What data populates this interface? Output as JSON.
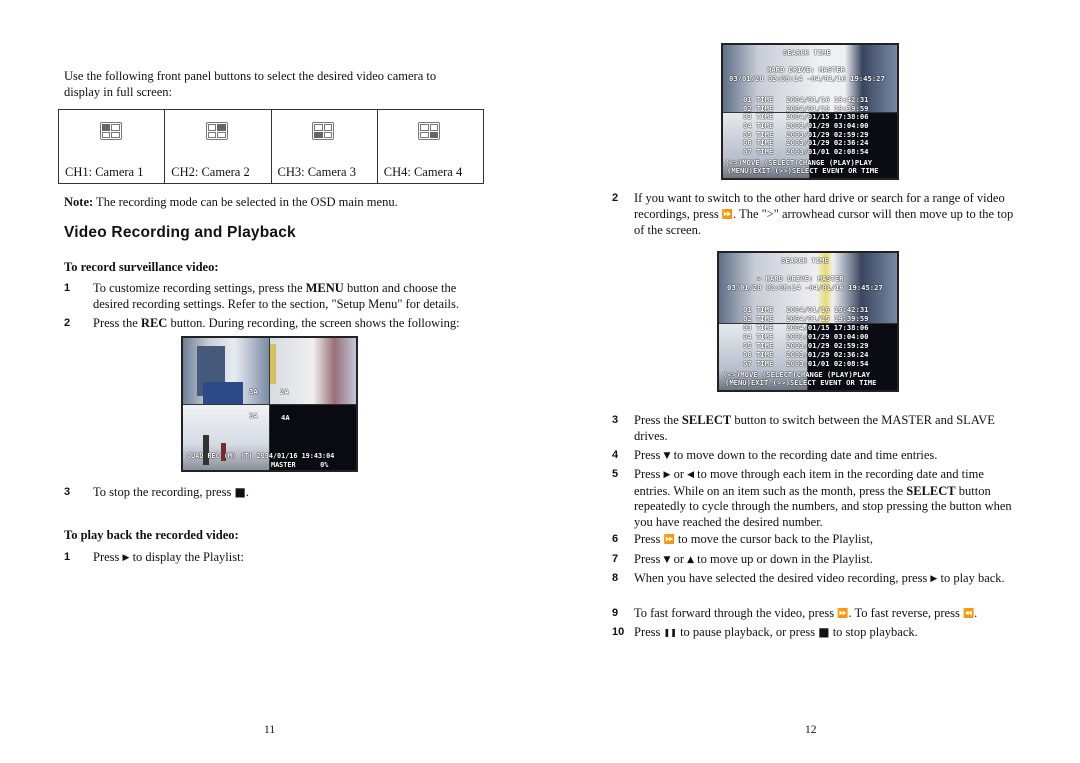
{
  "left_page": {
    "intro": "Use the following front panel buttons to select the desired video camera to display in full screen:",
    "cameras": [
      {
        "label": "CH1: Camera 1",
        "icon": "quad-view-ch1-icon",
        "active": 0
      },
      {
        "label": "CH2: Camera 2",
        "icon": "quad-view-ch2-icon",
        "active": 1
      },
      {
        "label": "CH3: Camera 3",
        "icon": "quad-view-ch3-icon",
        "active": 2
      },
      {
        "label": "CH4: Camera 4",
        "icon": "quad-view-ch4-icon",
        "active": 3
      }
    ],
    "note_label": "Note:",
    "note_text": " The recording mode can be selected in the OSD main menu.",
    "section_title": "Video Recording and Playback",
    "record_heading": "To record surveillance video:",
    "record_steps": [
      {
        "num": "1",
        "pre": "To customize recording settings, press the ",
        "bold": "MENU",
        "post": " button and choose the desired recording settings. Refer to the section, \"Setup Menu\" for details."
      },
      {
        "num": "2",
        "pre": "Press the ",
        "bold": "REC",
        "post": " button. During recording, the screen shows the following:"
      },
      {
        "num": "3",
        "pre": "To stop the recording, press ",
        "icon": "stop-icon",
        "post": "."
      }
    ],
    "recording_screen": {
      "quad_labels": [
        "3A",
        "2A",
        "3A",
        "4A"
      ],
      "status_line": "QUAD REC (M) (T) 2004/01/16 19:43:04",
      "drive_line": "MASTER      0%"
    },
    "playback_heading": "To play back the recorded video:",
    "playback_steps": [
      {
        "num": "1",
        "pre": "Press ",
        "icon": "play-icon",
        "post": " to display the Playlist:"
      }
    ],
    "page_number": "11"
  },
  "right_page": {
    "search_screen": {
      "title": "SEARCH TIME",
      "drive": "HARD DRIVE: MASTER",
      "drive_selected": "> HARD DRIVE: MASTER",
      "range_1": "03/01/20 02:08:14 -04/01/16 19:45:27",
      "entries": [
        "01 TIME   2004/01/16 19:42:31",
        "02 TIME   2004/01/15 19:39:59",
        "03 TIME   2004/01/15 17:38:06",
        "04 TIME   2003/01/29 03:04:00",
        "05 TIME   2003/01/29 02:59:29",
        "06 TIME   2003/01/29 02:36:24",
        "07 TIME   2003/01/01 02:08:54"
      ],
      "help_1": "(<>)MOVE (SELECT)CHANGE (PLAY)PLAY",
      "help_2": "(MENU)EXIT (>>)SELECT EVENT OR TIME"
    },
    "steps": [
      {
        "num": "2",
        "pre": "If you want to switch to the other hard drive or search for a range of video recordings, press ",
        "icon": "fast-forward-icon",
        "post": ". The \">\" arrowhead cursor will then move up to the top of the screen."
      },
      {
        "num": "3",
        "pre": "Press the ",
        "bold": "SELECT",
        "post": " button to switch between the MASTER and SLAVE drives."
      },
      {
        "num": "4",
        "pre": "Press ",
        "icon": "down-arrow-icon",
        "post": " to move down to the recording date and time entries."
      },
      {
        "num": "5",
        "pre": "Press ",
        "icon": "right-arrow-icon",
        "mid": " or ",
        "icon2": "left-arrow-icon",
        "post": " to move through each item in the recording date and time entries. While on an item such as the month, press the ",
        "bold2": "SELECT",
        "post2": " button repeatedly to cycle through the numbers, and stop pressing the button when you have reached the desired number."
      },
      {
        "num": "6",
        "pre": "Press ",
        "icon": "fast-forward-icon",
        "post": " to move the cursor back to the Playlist,"
      },
      {
        "num": "7",
        "pre": "Press ",
        "icon": "down-arrow-icon",
        "mid": " or ",
        "icon2": "up-arrow-icon",
        "post": " to move up or down in the Playlist."
      },
      {
        "num": "8",
        "pre": "When you have selected the desired video recording, press ",
        "icon": "play-icon",
        "post": " to play back."
      },
      {
        "num": "9",
        "pre": "To fast forward through the video, press ",
        "icon": "fast-forward-icon",
        "mid": ". To fast reverse, press ",
        "icon2": "rewind-icon",
        "post": "."
      },
      {
        "num": "10",
        "pre": "Press ",
        "icon": "pause-icon",
        "mid": " to pause playback, or press ",
        "icon2": "stop-icon",
        "post": " to stop playback."
      }
    ],
    "page_number": "12"
  },
  "glyphs": {
    "stop": "■",
    "play": "▶",
    "ff": "⏩",
    "rew": "⏪",
    "down": "▼",
    "up": "▲",
    "right": "▶",
    "left": "◀",
    "pause": "❚❚"
  }
}
